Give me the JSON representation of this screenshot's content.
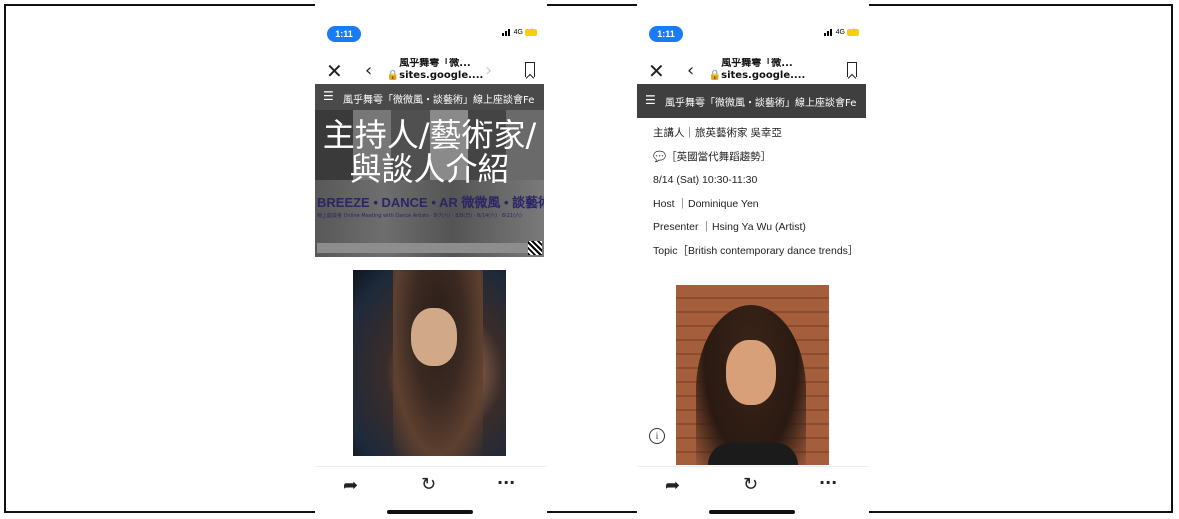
{
  "phones": [
    {
      "status_time": "1:11",
      "network": "4G",
      "nav": {
        "title": "風乎舞雩「微...",
        "url": "sites.google...."
      },
      "hero": {
        "header": "風乎舞雩「微微風・談藝術」線上座談會Fe",
        "title": "主持人/藝術家/與談人介紹",
        "brand": "BREEZE • DANCE • AR  微微風 • 談藝術",
        "subtitle": "線上座談會 Online Meeting with Dance Artists  ·  8/7(六) · 8/8(日) · 8/14(六) · 8/21(六)"
      }
    },
    {
      "status_time": "1:11",
      "network": "4G",
      "nav": {
        "title": "風乎舞雩「微...",
        "url": "sites.google...."
      },
      "header": "風乎舞雩「微微風・談藝術」線上座談會Fe",
      "lines": [
        "主講人｜旅英藝術家 吳幸亞",
        "💬［英國當代舞蹈趨勢］",
        "8/14 (Sat) 10:30-11:30",
        "Host ｜Dominique Yen",
        "Presenter ｜Hsing Ya Wu (Artist)",
        "Topic［British contemporary dance trends］"
      ]
    }
  ],
  "icons": {
    "close": "close-icon",
    "back": "chevron-left-icon",
    "forward": "chevron-right-icon",
    "bookmark": "bookmark-icon",
    "share": "share-icon",
    "reload": "reload-icon",
    "more": "more-icon",
    "info": "info-icon",
    "menu": "menu-icon"
  },
  "colors": {
    "time_pill": "#1a7cf5",
    "battery": "#f5d200",
    "header_bg": "#3f3f3f"
  }
}
